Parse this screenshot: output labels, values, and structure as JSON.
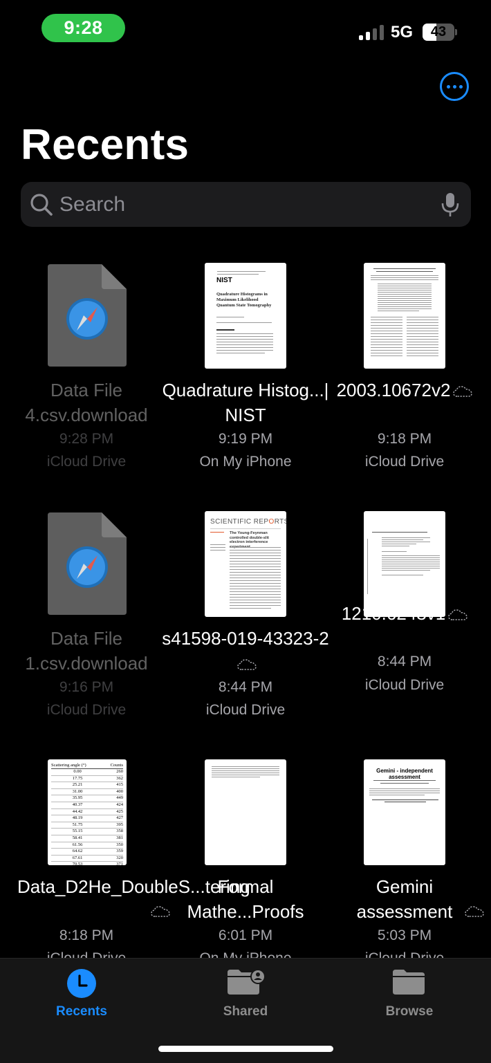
{
  "status_bar": {
    "time": "9:28",
    "network": "5G",
    "battery": "43",
    "battery_level": 0.43
  },
  "header": {
    "title": "Recents",
    "more_icon": "ellipsis-circle-icon"
  },
  "search": {
    "placeholder": "Search"
  },
  "files": [
    {
      "name": "Data File 4.csv.download",
      "time": "9:28 PM",
      "location": "iCloud Drive",
      "thumbnail": "safari-document-icon",
      "cloud": false,
      "dimmed": true
    },
    {
      "name": "Quadrature Histog...| NIST",
      "time": "9:19 PM",
      "location": "On My iPhone",
      "thumbnail": "nist-paper",
      "cloud": false,
      "dimmed": false
    },
    {
      "name": "2003.10672v2",
      "time": "9:18 PM",
      "location": "iCloud Drive",
      "thumbnail": "paper",
      "cloud": true,
      "dimmed": false
    },
    {
      "name": "Data File 1.csv.download",
      "time": "9:16 PM",
      "location": "iCloud Drive",
      "thumbnail": "safari-document-icon",
      "cloud": false,
      "dimmed": true
    },
    {
      "name": "s41598-019-43323-2",
      "time": "8:44 PM",
      "location": "iCloud Drive",
      "thumbnail": "scientific-reports-paper",
      "cloud": true,
      "dimmed": false
    },
    {
      "name": "1210.6243v1",
      "time": "8:44 PM",
      "location": "iCloud Drive",
      "thumbnail": "paper",
      "cloud": true,
      "dimmed": false
    },
    {
      "name": "Data_D2He_DoubleS...tering",
      "time": "8:18 PM",
      "location": "iCloud Drive",
      "thumbnail": "table-document",
      "cloud": true,
      "dimmed": false
    },
    {
      "name": "Formal Mathe...Proofs",
      "time": "6:01 PM",
      "location": "On My iPhone",
      "thumbnail": "paper",
      "cloud": false,
      "dimmed": false
    },
    {
      "name": "Gemini assessment",
      "time": "5:03 PM",
      "location": "iCloud Drive",
      "thumbnail": "gemini-paper",
      "cloud": true,
      "dimmed": false
    }
  ],
  "thumb_text": {
    "nist_title": "Quadrature Histograms in Maximum Likelihood Quantum State Tomography",
    "nist_logo": "NIST",
    "sr_logo_a": "SCIENTIFIC REP",
    "sr_logo_o": "O",
    "sr_logo_b": "RTS",
    "sr_title": "The Young-Feynman controlled double-slit electron interference experiment",
    "table_header_a": "Scattering angle (°)",
    "table_header_b": "Counts",
    "table_rows": [
      [
        "0.00",
        "260"
      ],
      [
        "17.75",
        "362"
      ],
      [
        "25.21",
        "415"
      ],
      [
        "31.00",
        "400"
      ],
      [
        "35.95",
        "449"
      ],
      [
        "40.37",
        "424"
      ],
      [
        "44.42",
        "425"
      ],
      [
        "48.19",
        "427"
      ],
      [
        "51.75",
        "395"
      ],
      [
        "55.15",
        "358"
      ],
      [
        "58.41",
        "381"
      ],
      [
        "61.56",
        "350"
      ],
      [
        "64.62",
        "359"
      ],
      [
        "67.61",
        "320"
      ],
      [
        "70.53",
        "371"
      ]
    ],
    "gemini_title": "Gemini - independent assessment"
  },
  "tabs": [
    {
      "label": "Recents",
      "icon": "clock-icon",
      "active": true
    },
    {
      "label": "Shared",
      "icon": "shared-folder-icon",
      "active": false
    },
    {
      "label": "Browse",
      "icon": "folder-icon",
      "active": false
    }
  ],
  "colors": {
    "accent": "#1a8cff",
    "time_pill": "#30c34b",
    "secondary_text": "#a6a6ab",
    "search_bg": "#1c1c1e"
  }
}
